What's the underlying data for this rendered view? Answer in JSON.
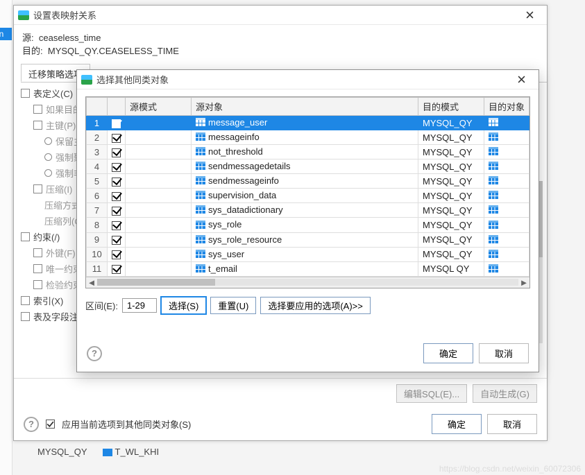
{
  "outer": {
    "title": "设置表映射关系",
    "source_label": "源:",
    "source_value": "ceaseless_time",
    "target_label": "目的:",
    "target_value": "MYSQL_QY.CEASELESS_TIME",
    "tab_label": "迁移策略选项",
    "tree": {
      "table_def": "表定义(C)",
      "if_target": "如果目的",
      "primary_key": "主键(P)",
      "keep_pk": "保留主",
      "force_cluster": "强制聚",
      "force_else": "强制非",
      "compress": "压缩(I)",
      "compress_mode": "压缩方式",
      "compress_col": "压缩列(O",
      "constraint": "约束(/)",
      "fk": "外键(F)",
      "unique": "唯一约束",
      "check": "检验约束",
      "index": "索引(X)",
      "table_field": "表及字段注"
    },
    "edit_sql": "编辑SQL(E)...",
    "auto_gen": "自动生成(G)",
    "help": "?",
    "apply_label": "应用当前选项到其他同类对象(S)",
    "ok": "确定",
    "cancel": "取消"
  },
  "inner": {
    "title": "选择其他同类对象",
    "cols": {
      "src_schema": "源模式",
      "src_obj": "源对象",
      "tgt_schema": "目的模式",
      "tgt_obj": "目的对象"
    },
    "rows": [
      {
        "n": "1",
        "sel": true,
        "src": "message_user",
        "tgt": "MYSQL_QY"
      },
      {
        "n": "2",
        "sel": false,
        "src": "messageinfo",
        "tgt": "MYSQL_QY"
      },
      {
        "n": "3",
        "sel": false,
        "src": "not_threshold",
        "tgt": "MYSQL_QY"
      },
      {
        "n": "4",
        "sel": false,
        "src": "sendmessagedetails",
        "tgt": "MYSQL_QY"
      },
      {
        "n": "5",
        "sel": false,
        "src": "sendmessageinfo",
        "tgt": "MYSQL_QY"
      },
      {
        "n": "6",
        "sel": false,
        "src": "supervision_data",
        "tgt": "MYSQL_QY"
      },
      {
        "n": "7",
        "sel": false,
        "src": "sys_datadictionary",
        "tgt": "MYSQL_QY"
      },
      {
        "n": "8",
        "sel": false,
        "src": "sys_role",
        "tgt": "MYSQL_QY"
      },
      {
        "n": "9",
        "sel": false,
        "src": "sys_role_resource",
        "tgt": "MYSQL_QY"
      },
      {
        "n": "10",
        "sel": false,
        "src": "sys_user",
        "tgt": "MYSQL_QY"
      },
      {
        "n": "11",
        "sel": false,
        "src": "t_email",
        "tgt": "MYSQL_QY",
        "last": true
      }
    ],
    "range_label": "区间(E):",
    "range_value": "1-29",
    "select_btn": "选择(S)",
    "reset_btn": "重置(U)",
    "options_btn": "选择要应用的选项(A)>>",
    "help": "?",
    "ok": "确定",
    "cancel": "取消"
  },
  "behind": {
    "schema": "MYSQL_QY",
    "obj": "T_WL_KHI"
  },
  "watermark": "https://blog.csdn.net/weixin_60072306"
}
